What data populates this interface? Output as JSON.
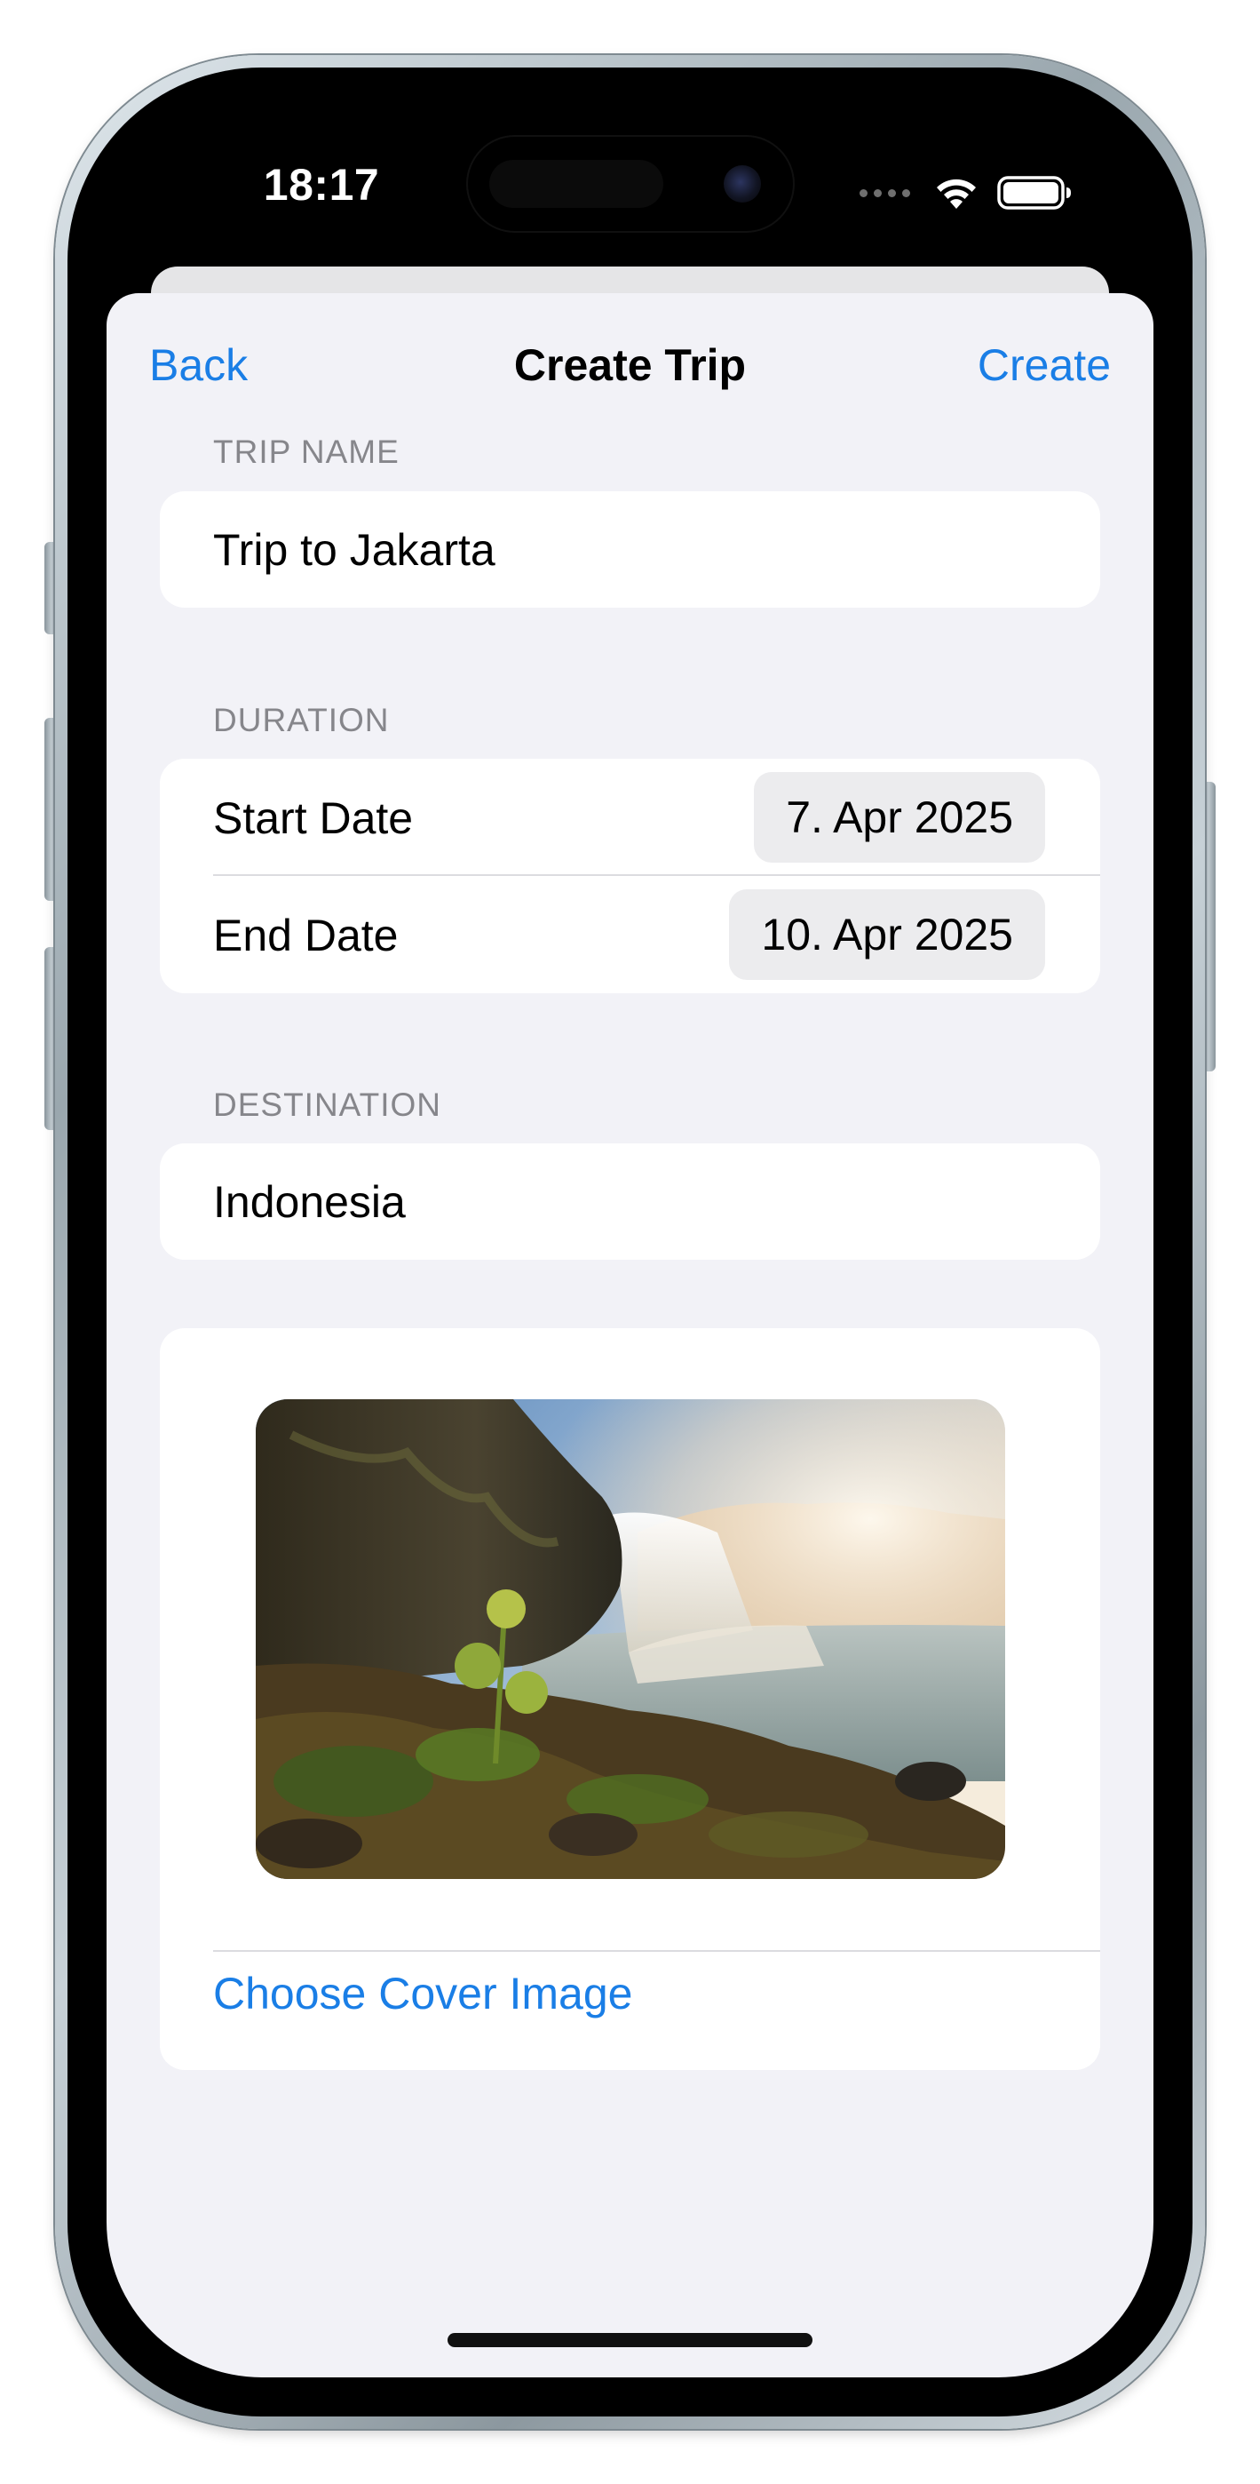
{
  "status_bar": {
    "time": "18:17",
    "icons": [
      "cellular-dots-icon",
      "wifi-icon",
      "battery-icon"
    ]
  },
  "nav": {
    "back_label": "Back",
    "title": "Create Trip",
    "create_label": "Create"
  },
  "form": {
    "trip_name": {
      "header": "TRIP NAME",
      "value": "Trip to Jakarta"
    },
    "duration": {
      "header": "DURATION",
      "start_label": "Start Date",
      "start_value": "7. Apr 2025",
      "end_label": "End Date",
      "end_value": "10. Apr 2025"
    },
    "destination": {
      "header": "DESTINATION",
      "value": "Indonesia"
    },
    "cover": {
      "image_name": "waterfall-landscape-photo",
      "choose_label": "Choose Cover Image"
    }
  },
  "colors": {
    "accent": "#1a7ee6",
    "sheet_background": "#f2f2f7",
    "card_background": "#ffffff",
    "section_header": "#86868b"
  }
}
